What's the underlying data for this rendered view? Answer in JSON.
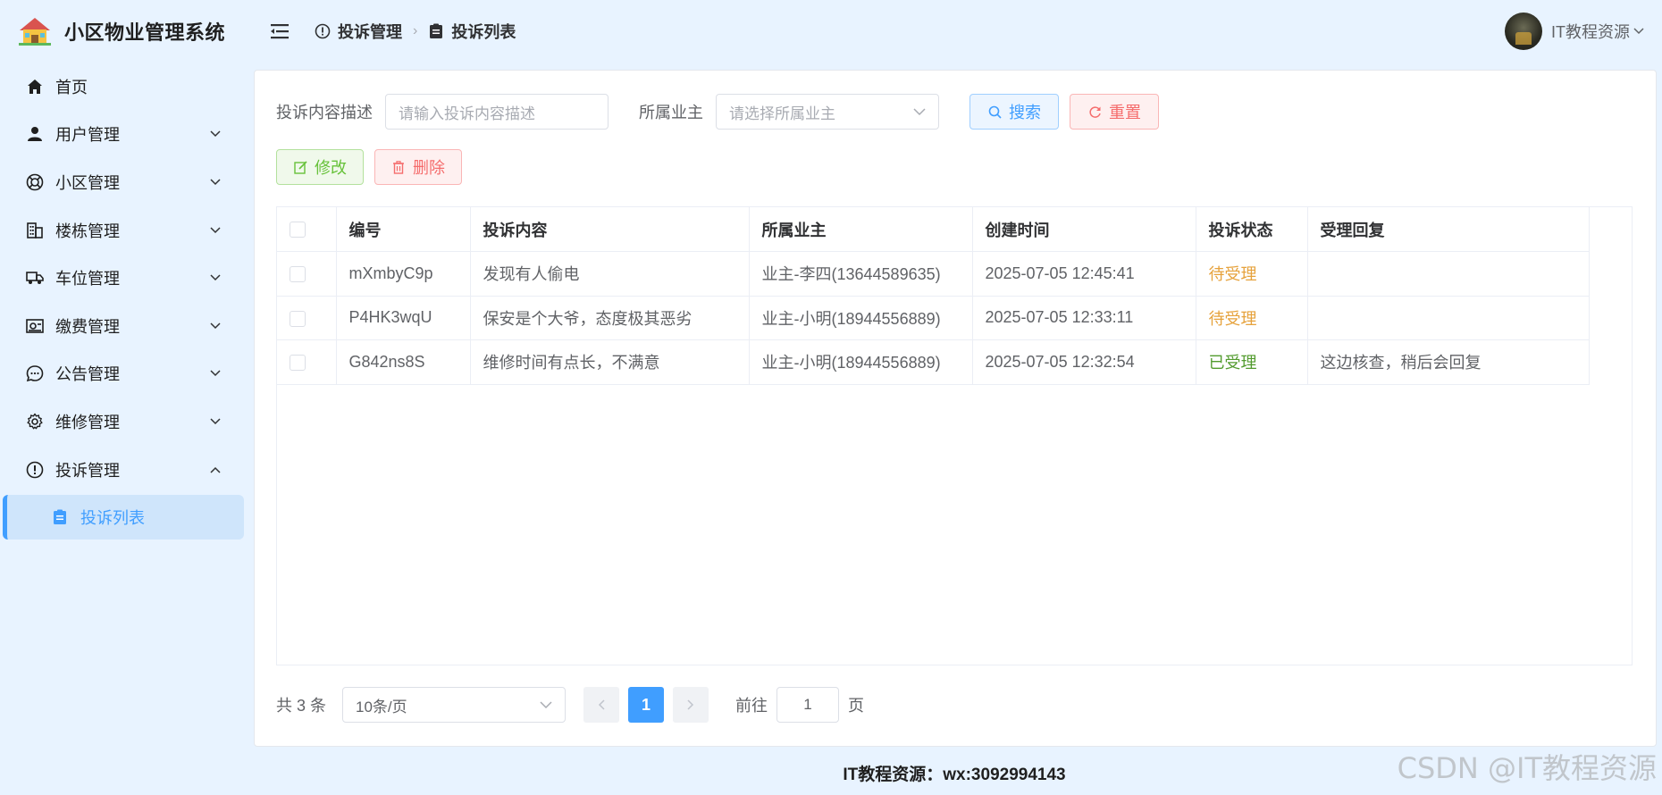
{
  "app": {
    "title": "小区物业管理系统"
  },
  "sidebar": {
    "items": [
      {
        "label": "首页",
        "icon": "home-icon",
        "expandable": false
      },
      {
        "label": "用户管理",
        "icon": "user-icon",
        "expandable": true
      },
      {
        "label": "小区管理",
        "icon": "community-icon",
        "expandable": true
      },
      {
        "label": "楼栋管理",
        "icon": "building-icon",
        "expandable": true
      },
      {
        "label": "车位管理",
        "icon": "truck-icon",
        "expandable": true
      },
      {
        "label": "缴费管理",
        "icon": "payment-icon",
        "expandable": true
      },
      {
        "label": "公告管理",
        "icon": "chat-icon",
        "expandable": true
      },
      {
        "label": "维修管理",
        "icon": "gear-icon",
        "expandable": true
      },
      {
        "label": "投诉管理",
        "icon": "warning-icon",
        "expandable": true,
        "expanded": true
      }
    ],
    "active_sub": {
      "label": "投诉列表",
      "icon": "clipboard-icon"
    }
  },
  "header": {
    "breadcrumb": [
      {
        "label": "投诉管理",
        "icon": "warning-icon"
      },
      {
        "label": "投诉列表",
        "icon": "clipboard-icon"
      }
    ],
    "user_name": "IT教程资源"
  },
  "filters": {
    "content_label": "投诉内容描述",
    "content_placeholder": "请输入投诉内容描述",
    "owner_label": "所属业主",
    "owner_placeholder": "请选择所属业主",
    "search_label": "搜索",
    "reset_label": "重置"
  },
  "actions": {
    "edit_label": "修改",
    "delete_label": "删除"
  },
  "table": {
    "columns": [
      "编号",
      "投诉内容",
      "所属业主",
      "创建时间",
      "投诉状态",
      "受理回复"
    ],
    "rows": [
      {
        "id": "mXmbyC9p",
        "content": "发现有人偷电",
        "owner": "业主-李四(13644589635)",
        "created": "2025-07-05 12:45:41",
        "status": "待受理",
        "status_type": "pending",
        "reply": ""
      },
      {
        "id": "P4HK3wqU",
        "content": "保安是个大爷，态度极其恶劣",
        "owner": "业主-小明(18944556889)",
        "created": "2025-07-05 12:33:11",
        "status": "待受理",
        "status_type": "pending",
        "reply": ""
      },
      {
        "id": "G842ns8S",
        "content": "维修时间有点长，不满意",
        "owner": "业主-小明(18944556889)",
        "created": "2025-07-05 12:32:54",
        "status": "已受理",
        "status_type": "done",
        "reply": "这边核查，稍后会回复"
      }
    ]
  },
  "pagination": {
    "total_text": "共 3 条",
    "page_size": "10条/页",
    "current_page": "1",
    "goto_label": "前往",
    "goto_value": "1",
    "page_unit": "页"
  },
  "footer": {
    "text": "IT教程资源：wx:3092994143"
  },
  "watermark": {
    "text": "CSDN @IT教程资源"
  },
  "colors": {
    "primary": "#409eff",
    "warning": "#e6a23c",
    "success": "#67c23a",
    "danger": "#f56c6c",
    "sidebar_bg": "#e8f3ff"
  }
}
